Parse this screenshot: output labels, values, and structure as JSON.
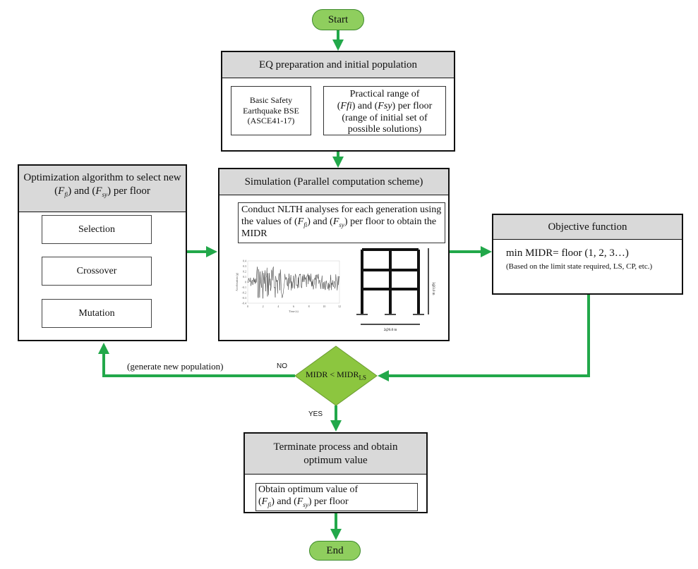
{
  "start_label": "Start",
  "end_label": "End",
  "eq_box": {
    "title": "EQ preparation and initial population",
    "bse": "Basic Safety Earthquake BSE (ASCE41-17)",
    "range": {
      "prefix": "Practical range of",
      "ffi": "Ffi",
      "and": "and",
      "fsy": "Fsy",
      "suffix": "per floor (range of initial set of possible solutions)"
    }
  },
  "simulation_box": {
    "title": "Simulation (Parallel computation scheme)",
    "text_prefix": "Conduct NLTH analyses for each generation using the values of",
    "text_suffix": "per floor to obtain the MIDR",
    "record_plot": {
      "y_ticks": [
        "0.4",
        "0.3",
        "0.2",
        "0.1",
        "0",
        "-0.1",
        "-0.2",
        "-0.3",
        "-0.4"
      ],
      "x_ticks": [
        "0",
        "2",
        "4",
        "6",
        "8",
        "10",
        "12"
      ],
      "xlabel": "Time (s)",
      "ylabel": "Acceleration (g)"
    },
    "frame": {
      "height_label": "3@3.0 m",
      "width_label": "2@6.0 m"
    }
  },
  "optimization_box": {
    "title_prefix": "Optimization algorithm to select new",
    "title_suffix": "per floor",
    "steps": [
      "Selection",
      "Crossover",
      "Mutation"
    ]
  },
  "objective_box": {
    "title": "Objective function",
    "formula": "min MIDR= floor (1, 2, 3…)",
    "note": "(Based on the limit state required, LS, CP, etc.)"
  },
  "decision": {
    "text": "MIDR < MIDR",
    "subscript": "LS",
    "no_label": "NO",
    "yes_label": "YES",
    "loop_label": "(generate new population)"
  },
  "terminate_box": {
    "title": "Terminate process and obtain optimum value",
    "text_prefix": "Obtain optimum value of",
    "text_suffix": "per floor"
  },
  "colors": {
    "arrow": "#22a84a",
    "pill": "#8fce5e",
    "diamond": "#8cc63f",
    "header": "#d9d9d9"
  }
}
